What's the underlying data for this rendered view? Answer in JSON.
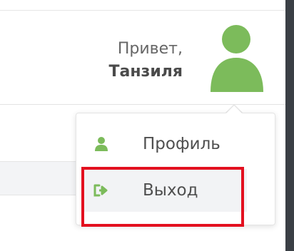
{
  "header": {
    "greeting_line1": "Привет,",
    "greeting_name": "Танзиля"
  },
  "dropdown": {
    "items": [
      {
        "label": "Профиль",
        "icon": "user-icon"
      },
      {
        "label": "Выход",
        "icon": "sign-out-icon"
      }
    ]
  },
  "colors": {
    "accent_green": "#7cbb5b",
    "highlight_red": "#e3101f"
  }
}
